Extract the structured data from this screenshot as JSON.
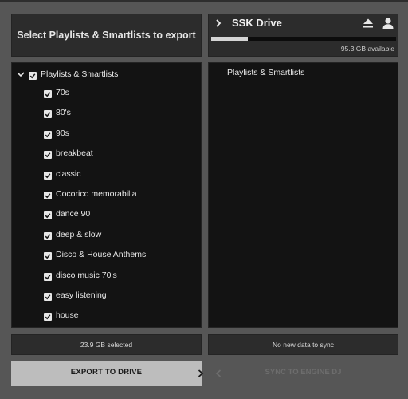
{
  "header": {
    "title": "Select Playlists & Smartlists to export"
  },
  "drive": {
    "name": "SSK Drive",
    "available": "95.3 GB available",
    "usage_fraction": 0.2,
    "icons": [
      "chevron-right-icon",
      "eject-icon",
      "user-icon"
    ]
  },
  "tree": {
    "root_label": "Playlists & Smartlists",
    "root_checked": true,
    "items": [
      {
        "label": "70s",
        "checked": true
      },
      {
        "label": "80's",
        "checked": true
      },
      {
        "label": "90s",
        "checked": true
      },
      {
        "label": "breakbeat",
        "checked": true
      },
      {
        "label": "classic",
        "checked": true
      },
      {
        "label": "Cocorico memorabilia",
        "checked": true
      },
      {
        "label": "dance 90",
        "checked": true
      },
      {
        "label": "deep & slow",
        "checked": true
      },
      {
        "label": "Disco & House Anthems",
        "checked": true
      },
      {
        "label": "disco music 70's",
        "checked": true
      },
      {
        "label": "easy listening",
        "checked": true
      },
      {
        "label": "house",
        "checked": true
      }
    ]
  },
  "drive_pane": {
    "label": "Playlists & Smartlists"
  },
  "status": {
    "selected": "23.9 GB selected",
    "sync": "No new data to sync"
  },
  "actions": {
    "export_label": "EXPORT TO DRIVE",
    "sync_label": "SYNC TO ENGINE DJ"
  },
  "colors": {
    "background": "#565656",
    "panel": "#2c2c2c",
    "list_bg": "#131313",
    "export_button": "#bdbdbd",
    "checkbox": "#e6e6e6"
  }
}
